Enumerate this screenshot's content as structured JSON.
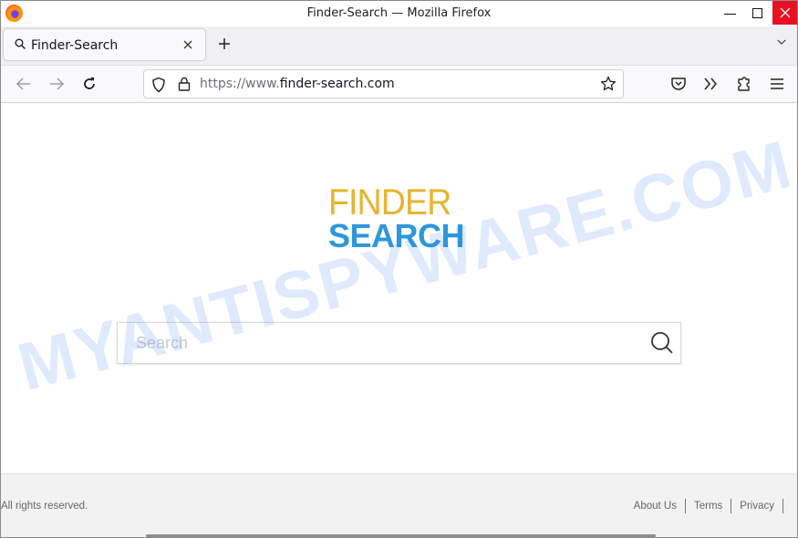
{
  "window": {
    "title": "Finder-Search — Mozilla Firefox",
    "close_color": "#e81123"
  },
  "tabs": [
    {
      "label": "Finder-Search",
      "icon": "search-icon",
      "active": true
    }
  ],
  "navbar": {
    "url_prefix": "https://www.",
    "url_domain": "finder-search.com",
    "icons": [
      "back-arrow-icon",
      "forward-arrow-icon",
      "reload-icon",
      "shield-icon",
      "lock-icon",
      "bookmark-star-icon",
      "pocket-icon",
      "overflow-chevrons-icon",
      "extensions-puzzle-icon",
      "hamburger-menu-icon"
    ]
  },
  "page": {
    "logo_top": "FINDER",
    "logo_bottom": "SEARCH",
    "logo_colors": {
      "top": "#e8b42e",
      "bottom": "#2e97db"
    },
    "search_placeholder": "Search",
    "search_value": "",
    "watermark": "MYANTISPYWARE.COM"
  },
  "footer": {
    "copyright": "All rights reserved.",
    "links": [
      "About Us",
      "Terms",
      "Privacy"
    ]
  }
}
